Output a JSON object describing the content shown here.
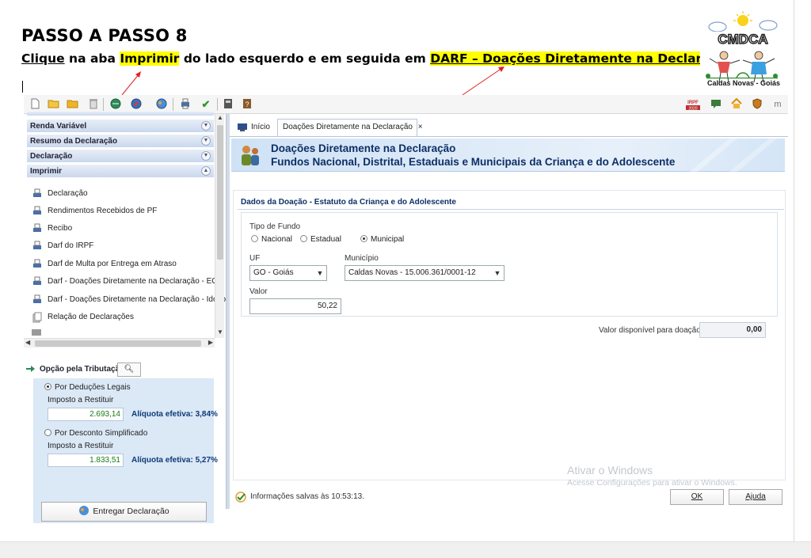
{
  "doc": {
    "title": "PASSO A PASSO 8",
    "instr_1": "Clique",
    "instr_2": "  na aba ",
    "instr_3": "Imprimir",
    "instr_4": " do lado esquerdo e em seguida em ",
    "instr_5": "DARF – Doações Diretamente na Declaração - I",
    "logo_text": "Caldas Novas - Goiás",
    "logo_word": "CMDCA"
  },
  "toolbar": {
    "icons": [
      "new-file-icon",
      "open-folder-icon",
      "folder-icon",
      "trash-icon",
      "globe-refresh-icon",
      "globe-arrow-icon",
      "globe-icon",
      "printer-icon",
      "check-icon",
      "calculator-icon",
      "book-icon"
    ],
    "right_badge": "IRPF",
    "right_badge_year": "2020"
  },
  "left_menu": {
    "headers": [
      {
        "label": "Renda Variável"
      },
      {
        "label": "Resumo da Declaração"
      },
      {
        "label": "Declaração"
      },
      {
        "label": "Imprimir"
      }
    ],
    "items": [
      {
        "label": "Declaração"
      },
      {
        "label": "Rendimentos Recebidos de PF"
      },
      {
        "label": "Recibo"
      },
      {
        "label": "Darf do IRPF"
      },
      {
        "label": "Darf de Multa por Entrega em Atraso"
      },
      {
        "label": "Darf - Doações Diretamente na Declaração - ECA"
      },
      {
        "label": "Darf - Doações Diretamente na Declaração - Idoso"
      },
      {
        "label": "Relação de Declarações"
      }
    ]
  },
  "tributacao": {
    "header": "Opção pela Tributação:",
    "opt1": "Por Deduções Legais",
    "opt1_label": "Imposto a Restituir",
    "opt1_value": "2.693,14",
    "opt1_aliq": "Alíquota efetiva: 3,84%",
    "opt2": "Por Desconto Simplificado",
    "opt2_label": "Imposto a Restituir",
    "opt2_value": "1.833,51",
    "opt2_aliq": "Alíquota efetiva: 5,27%",
    "entregar": "Entregar Declaração"
  },
  "tabs": {
    "home": "Início",
    "active": "Doações Diretamente na Declaração",
    "close": "×"
  },
  "banner": {
    "line1": "Doações Diretamente na Declaração",
    "line2": "Fundos Nacional, Distrital, Estaduais e Municipais da Criança e do Adolescente"
  },
  "form": {
    "section_title": "Dados da Doação - Estatuto da Criança e do Adolescente",
    "tipo_label": "Tipo de Fundo",
    "tipo_options": [
      "Nacional",
      "Estadual",
      "Municipal"
    ],
    "tipo_selected": "Municipal",
    "uf_label": "UF",
    "uf_value": "GO - Goiás",
    "municipio_label": "Município",
    "municipio_value": "Caldas Novas - 15.006.361/0001-12",
    "valor_label": "Valor",
    "valor_value": "50,22",
    "disp_label": "Valor disponível para doação:",
    "disp_value": "0,00"
  },
  "footer": {
    "status": "Informações salvas às 10:53:13.",
    "ok": "OK",
    "ajuda": "Ajuda"
  },
  "watermark": {
    "line1": "Ativar o Windows",
    "line2": "Acesse Configurações para ativar o Windows."
  }
}
